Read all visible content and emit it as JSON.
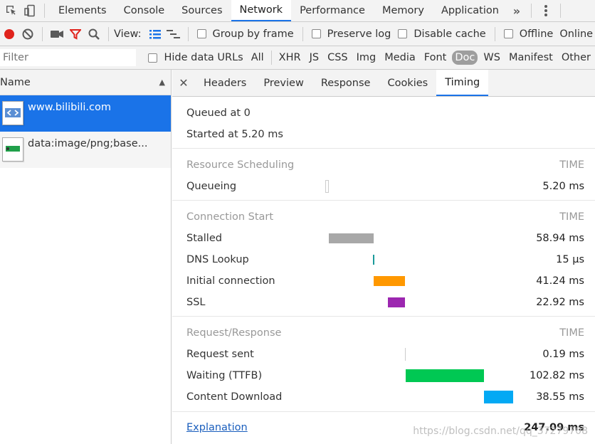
{
  "topbar": {
    "tabs": [
      "Elements",
      "Console",
      "Sources",
      "Network",
      "Performance",
      "Memory",
      "Application"
    ],
    "active_tab": "Network",
    "more_icon": "double-chevron-right-icon",
    "kebab_icon": "kebab-menu-icon"
  },
  "toolbar": {
    "view_label": "View:",
    "group_by_frame": "Group by frame",
    "preserve_log": "Preserve log",
    "disable_cache": "Disable cache",
    "offline": "Offline",
    "online": "Online"
  },
  "filterbar": {
    "placeholder": "Filter",
    "hide_data_urls": "Hide data URLs",
    "types": [
      "All",
      "XHR",
      "JS",
      "CSS",
      "Img",
      "Media",
      "Font",
      "Doc",
      "WS",
      "Manifest",
      "Other"
    ],
    "selected_type": "Doc"
  },
  "requests": {
    "header": "Name",
    "items": [
      {
        "name": "www.bilibili.com",
        "icon": "html-document-icon",
        "selected": true
      },
      {
        "name": "data:image/png;base...",
        "icon": "image-file-icon",
        "selected": false
      }
    ]
  },
  "detail": {
    "tabs": [
      "Headers",
      "Preview",
      "Response",
      "Cookies",
      "Timing"
    ],
    "active_tab": "Timing",
    "close_icon": "close-icon",
    "queued": "Queued at 0",
    "started": "Started at 5.20 ms",
    "time_label": "TIME",
    "sections": [
      {
        "title": "Resource Scheduling",
        "rows": [
          {
            "label": "Queueing",
            "value": "5.20 ms",
            "color": "#ffffff"
          }
        ]
      },
      {
        "title": "Connection Start",
        "rows": [
          {
            "label": "Stalled",
            "value": "58.94 ms",
            "color": "#a8a8a8"
          },
          {
            "label": "DNS Lookup",
            "value": "15 µs",
            "color": "#1a9a9a"
          },
          {
            "label": "Initial connection",
            "value": "41.24 ms",
            "color": "#ff9800"
          },
          {
            "label": "SSL",
            "value": "22.92 ms",
            "color": "#9c27b0"
          }
        ]
      },
      {
        "title": "Request/Response",
        "rows": [
          {
            "label": "Request sent",
            "value": "0.19 ms",
            "color": "#cccccc"
          },
          {
            "label": "Waiting (TTFB)",
            "value": "102.82 ms",
            "color": "#00c853"
          },
          {
            "label": "Content Download",
            "value": "38.55 ms",
            "color": "#03a9f4"
          }
        ]
      }
    ],
    "explanation": "Explanation",
    "total": "247.09 ms"
  },
  "watermark": "https://blog.csdn.net/qq_37279708"
}
